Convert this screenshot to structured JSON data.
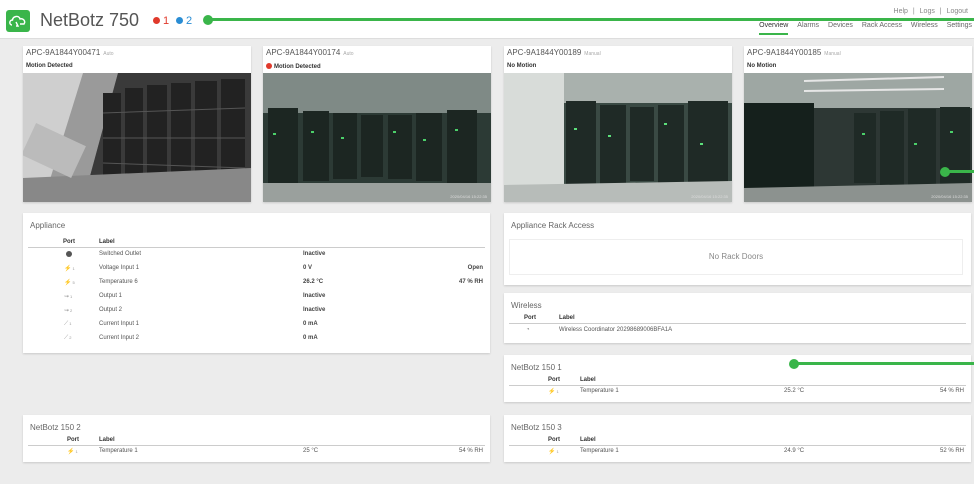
{
  "header": {
    "title": "NetBotz 750",
    "alarm_critical": "1",
    "alarm_info": "2",
    "top_links": [
      "Help",
      "|",
      "Logs",
      "|",
      "Logout"
    ],
    "nav": [
      "Overview",
      "Alarms",
      "Devices",
      "Rack Access",
      "Wireless",
      "Settings"
    ],
    "active_nav": "Overview"
  },
  "cameras": [
    {
      "name": "APC-9A1844Y00471",
      "mode": "Auto",
      "status": "Motion Detected",
      "alert": false,
      "timestamp": ""
    },
    {
      "name": "APC-9A1844Y00174",
      "mode": "Auto",
      "status": "Motion Detected",
      "alert": true,
      "timestamp": "2020/04/16 15:22:35"
    },
    {
      "name": "APC-9A1844Y00189",
      "mode": "Manual",
      "status": "No Motion",
      "alert": false,
      "timestamp": "2020/04/16 15:22:35"
    },
    {
      "name": "APC-9A1844Y00185",
      "mode": "Manual",
      "status": "No Motion",
      "alert": false,
      "timestamp": "2020/04/16 15:22:35"
    }
  ],
  "appliance": {
    "title": "Appliance",
    "headers": {
      "port": "Port",
      "label": "Label"
    },
    "rows": [
      {
        "icon": "outlet-icon",
        "port": "",
        "label": "Switched Outlet",
        "value": "Inactive",
        "extra": ""
      },
      {
        "icon": "sensor-icon",
        "port": "1",
        "label": "Voltage Input 1",
        "value": "0 V",
        "extra": "Open"
      },
      {
        "icon": "sensor-icon",
        "port": "5",
        "label": "Temperature 6",
        "value": "26.2 °C",
        "extra": "47 % RH"
      },
      {
        "icon": "output-icon",
        "port": "1",
        "label": "Output 1",
        "value": "Inactive",
        "extra": ""
      },
      {
        "icon": "output-icon",
        "port": "2",
        "label": "Output 2",
        "value": "Inactive",
        "extra": ""
      },
      {
        "icon": "current-icon",
        "port": "1",
        "label": "Current Input 1",
        "value": "0 mA",
        "extra": ""
      },
      {
        "icon": "current-icon",
        "port": "2",
        "label": "Current Input 2",
        "value": "0 mA",
        "extra": ""
      }
    ]
  },
  "rack_access": {
    "title": "Appliance Rack Access",
    "empty": "No Rack Doors"
  },
  "wireless": {
    "title": "Wireless",
    "headers": {
      "port": "Port",
      "label": "Label"
    },
    "rows": [
      {
        "icon": "wireless-icon",
        "label": "Wireless Coordinator 20298689006BFA1A"
      }
    ]
  },
  "nb1": {
    "title": "NetBotz 150 1",
    "headers": {
      "port": "Port",
      "label": "Label"
    },
    "row": {
      "port": "1",
      "label": "Temperature 1",
      "value": "25.2 °C",
      "extra": "54 % RH"
    }
  },
  "nb2": {
    "title": "NetBotz 150 2",
    "headers": {
      "port": "Port",
      "label": "Label"
    },
    "row": {
      "port": "1",
      "label": "Temperature 1",
      "value": "25 °C",
      "extra": "54 % RH"
    }
  },
  "nb3": {
    "title": "NetBotz 150 3",
    "headers": {
      "port": "Port",
      "label": "Label"
    },
    "row": {
      "port": "1",
      "label": "Temperature 1",
      "value": "24.9 °C",
      "extra": "52 % RH"
    }
  },
  "colors": {
    "accent": "#3ab54a",
    "critical": "#e0392b",
    "info": "#2a8dd4"
  }
}
